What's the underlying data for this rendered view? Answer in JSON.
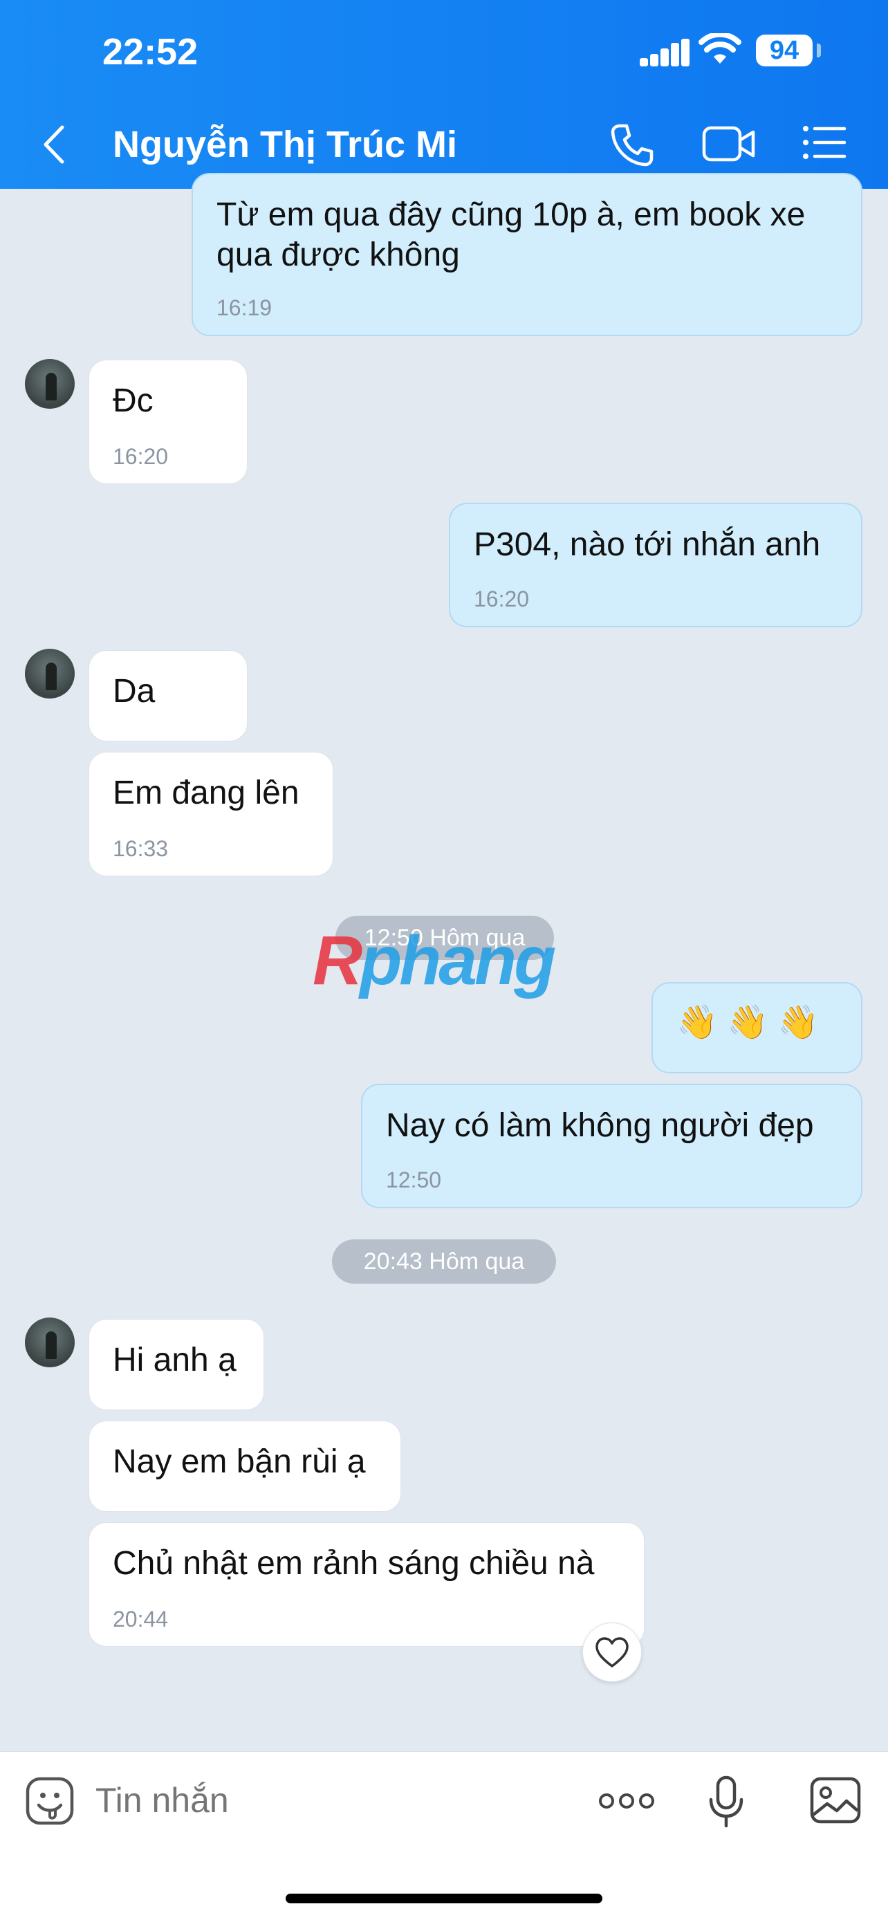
{
  "status_bar": {
    "time": "22:52",
    "battery": "94"
  },
  "header": {
    "contact_name": "Nguyễn Thị Trúc Mi"
  },
  "messages": [
    {
      "text": "Từ em qua đây cũng 10p à, em book xe qua được không",
      "time": "16:19"
    },
    {
      "text": "Đc",
      "time": "16:20"
    },
    {
      "text": "P304, nào tới nhắn anh",
      "time": "16:20"
    },
    {
      "text": "Da"
    },
    {
      "text": "Em đang lên",
      "time": "16:33"
    },
    {
      "separator": "12:50 Hôm qua"
    },
    {
      "text": "👋 👋 👋"
    },
    {
      "text": "Nay có làm không người đẹp",
      "time": "12:50"
    },
    {
      "separator": "20:43 Hôm qua"
    },
    {
      "text": "Hi anh ạ"
    },
    {
      "text": "Nay em bận rùi ạ"
    },
    {
      "text": "Chủ nhật em rảnh sáng chiều nà",
      "time": "20:44"
    }
  ],
  "watermark": {
    "r": "R",
    "rest": "phang"
  },
  "composer": {
    "placeholder": "Tin nhắn"
  }
}
